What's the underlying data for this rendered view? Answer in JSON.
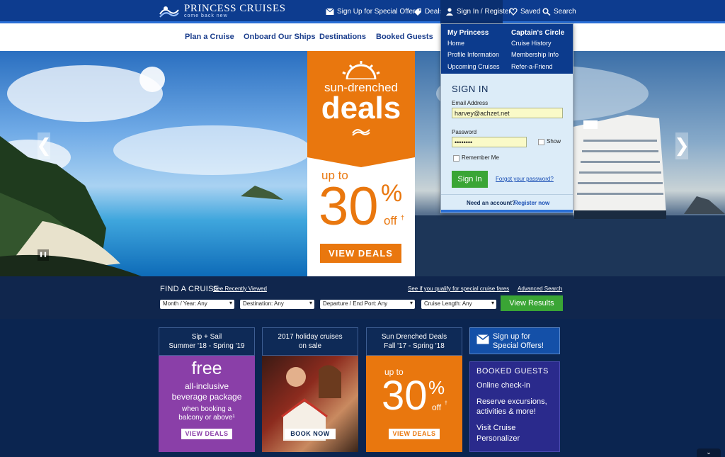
{
  "header": {
    "logo_title": "PRINCESS CRUISES",
    "logo_tagline": "come back new",
    "links": {
      "special_offers": "Sign Up for Special Offers",
      "deals": "Deals",
      "signin": "Sign In / Register",
      "saved": "Saved",
      "search": "Search"
    }
  },
  "nav": {
    "items": [
      "Plan a Cruise",
      "Onboard Our Ships",
      "Destinations",
      "Booked Guests"
    ]
  },
  "hero": {
    "promo_line1": "sun-drenched",
    "promo_line2": "deals",
    "up_to": "up to",
    "percent": "30",
    "percent_sign": "%",
    "off": "off",
    "dagger": "†",
    "cta": "VIEW DEALS",
    "prev": "❮",
    "next": "❯",
    "pause": "❚❚"
  },
  "dropdown": {
    "my_princess": "My Princess",
    "my_links": [
      "Home",
      "Profile Information",
      "Upcoming Cruises"
    ],
    "captains_circle": "Captain's Circle",
    "cc_links": [
      "Cruise History",
      "Membership Info",
      "Refer-a-Friend"
    ],
    "title": "SIGN IN",
    "email_label": "Email Address",
    "email_value": "harvey@achzet.net",
    "password_label": "Password",
    "password_value": "••••••••",
    "show_label": "Show",
    "remember_label": "Remember Me",
    "signin_button": "Sign In",
    "forgot": "Forgot your password?",
    "need_account": "Need an account?",
    "register": "Register now"
  },
  "finder": {
    "title": "FIND A CRUISE",
    "recent": "See Recently Viewed",
    "qualify": "See if you qualify for special cruise fares",
    "advanced": "Advanced Search",
    "selects": [
      "Month / Year: Any",
      "Destination: Any",
      "Departure / End Port: Any",
      "Cruise Length: Any"
    ],
    "button": "View Results"
  },
  "cards": {
    "c1": {
      "h1": "Sip + Sail",
      "h2": "Summer '18 - Spring '19",
      "big": "free",
      "l1": "all-inclusive",
      "l2": "beverage package",
      "s1": "when booking a",
      "s2": "balcony or above¹",
      "btn": "VIEW DEALS"
    },
    "c2": {
      "h1": "2017 holiday cruises",
      "h2": "on sale",
      "btn": "BOOK NOW"
    },
    "c3": {
      "h1": "Sun Drenched Deals",
      "h2": "Fall '17 - Spring '18",
      "up": "up to",
      "pct": "30",
      "pcts": "%",
      "off": "off",
      "dag": "†",
      "btn": "VIEW DEALS"
    },
    "c4": {
      "signup1": "Sign up for",
      "signup2": "Special Offers!",
      "bg_title": "BOOKED GUESTS",
      "l1": "Online check-in",
      "l2a": "Reserve excursions,",
      "l2b": "activities & more!",
      "l3a": "Visit Cruise",
      "l3b": "Personalizer"
    }
  },
  "colors": {
    "brand_blue": "#0d3c8f",
    "orange": "#e9770e",
    "purple": "#8a3fa8",
    "green": "#3aa535"
  }
}
